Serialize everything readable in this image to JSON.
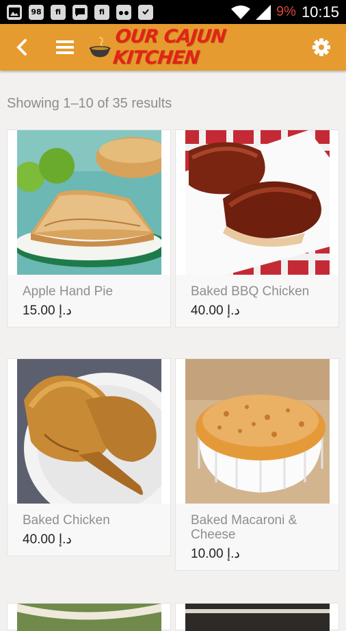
{
  "status_bar": {
    "notification_icons": [
      "image-icon",
      "98",
      "fi",
      "chat-icon",
      "fi",
      "cyanogen-icon",
      "clipboard-check-icon"
    ],
    "notif_98": "98",
    "notif_fi": "fi",
    "battery": "9%",
    "time": "10:15"
  },
  "app_bar": {
    "logo_text": "OUR CAJUN KITCHEN",
    "accent_color": "#e59b2f",
    "logo_color": "#e2231a"
  },
  "results_text": "Showing 1–10 of 35 results",
  "products": [
    {
      "name": "Apple Hand Pie",
      "price": "15.00 د.إ"
    },
    {
      "name": "Baked BBQ Chicken",
      "price": "40.00 د.إ"
    },
    {
      "name": "Baked Chicken",
      "price": "40.00 د.إ"
    },
    {
      "name": "Baked Macaroni & Cheese",
      "price": "10.00 د.إ"
    }
  ]
}
